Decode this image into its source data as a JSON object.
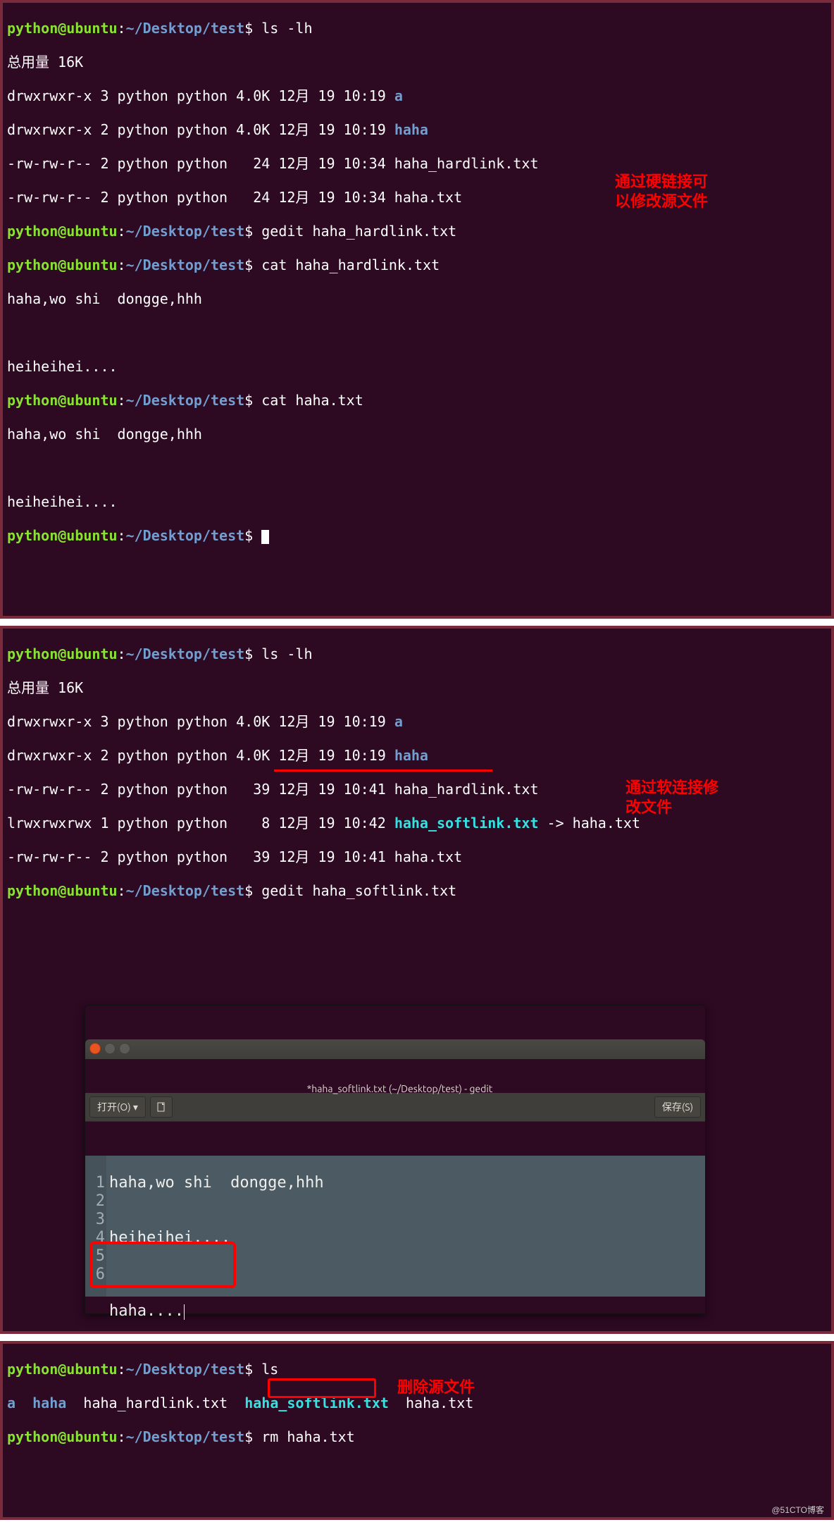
{
  "prompt": {
    "user": "python@ubuntu",
    "sep1": ":",
    "path": "~/Desktop/test",
    "sep2": "$"
  },
  "term1": {
    "cmd1": "ls -lh",
    "total": "总用量 16K",
    "l1a": "drwxrwxr-x 3 python python 4.0K 12月 19 10:19 ",
    "l1b": "a",
    "l2a": "drwxrwxr-x 2 python python 4.0K 12月 19 10:19 ",
    "l2b": "haha",
    "l3": "-rw-rw-r-- 2 python python   24 12月 19 10:34 haha_hardlink.txt",
    "l4": "-rw-rw-r-- 2 python python   24 12月 19 10:34 haha.txt",
    "cmd2": "gedit haha_hardlink.txt",
    "cmd3": "cat haha_hardlink.txt",
    "out1": "haha,wo shi  dongge,hhh",
    "blank": " ",
    "out2": "heiheihei....",
    "cmd4": "cat haha.txt",
    "out3": "haha,wo shi  dongge,hhh",
    "out4": "heiheihei....",
    "annotation": "通过硬链接可\n以修改源文件"
  },
  "term2": {
    "cmd1": "ls -lh",
    "total": "总用量 16K",
    "l1a": "drwxrwxr-x 3 python python 4.0K 12月 19 10:19 ",
    "l1b": "a",
    "l2a": "drwxrwxr-x 2 python python 4.0K 12月 19 10:19 ",
    "l2b": "haha",
    "l3": "-rw-rw-r-- 2 python python   39 12月 19 10:41 haha_hardlink.txt",
    "l4a": "lrwxrwxrwx 1 python python    8 12月 19 10:42 ",
    "l4b": "haha_softlink.txt",
    "l4c": " -> haha.txt",
    "l5": "-rw-rw-r-- 2 python python   39 12月 19 10:41 haha.txt",
    "cmd2": "gedit haha_softlink.txt",
    "annotation": "通过软连接修\n改文件"
  },
  "gedit": {
    "title": "*haha_softlink.txt (~/Desktop/test) - gedit",
    "open": "打开(O) ▾",
    "save": "保存(S)",
    "lines": {
      "n1": "1",
      "t1": "haha,wo shi  dongge,hhh",
      "n2": "2",
      "t2": "",
      "n3": "3",
      "t3": "heiheihei....",
      "n4": "4",
      "t4": "",
      "n5": "5",
      "t5": "",
      "n6": "6",
      "t6": "haha...."
    }
  },
  "term3": {
    "cmd1": "ls",
    "ls_a": "a",
    "ls_haha": "haha",
    "ls_hard": "haha_hardlink.txt",
    "ls_soft": "haha_softlink.txt",
    "ls_src": "haha.txt",
    "cmd2_a": "rm ",
    "cmd2_b": "haha.txt",
    "annotation": "删除源文件",
    "watermark": "@51CTO博客"
  }
}
